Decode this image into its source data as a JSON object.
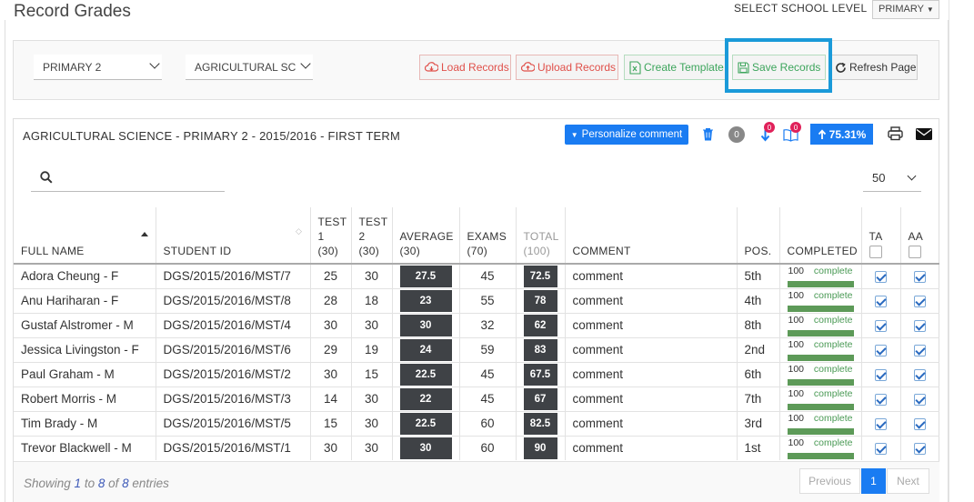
{
  "page": {
    "title": "Record Grades"
  },
  "school_level": {
    "label": "SELECT SCHOOL LEVEL",
    "value": "PRIMARY"
  },
  "filters": {
    "class": "PRIMARY 2",
    "subject": "AGRICULTURAL SC"
  },
  "toolbar": {
    "load": "Load Records",
    "upload": "Upload Records",
    "template": "Create Template",
    "save": "Save Records",
    "refresh": "Refresh Page"
  },
  "grid": {
    "title": "AGRICULTURAL SCIENCE - PRIMARY 2 - 2015/2016 - FIRST TERM",
    "personalize": "Personalize comment",
    "count": "0",
    "notif1": "0",
    "notif2": "0",
    "percent": "75.31%",
    "page_size": "50",
    "search_placeholder": ""
  },
  "columns": {
    "full_name": "FULL NAME",
    "student_id": "STUDENT ID",
    "test1_l1": "TEST",
    "test1_l2": "1",
    "test1_l3": "(30)",
    "test2_l1": "TEST",
    "test2_l2": "2",
    "test2_l3": "(30)",
    "avg_l1": "AVERAGE",
    "avg_l2": "(30)",
    "exam_l1": "EXAMS",
    "exam_l2": "(70)",
    "total_l1": "TOTAL",
    "total_l2": "(100)",
    "comment": "COMMENT",
    "pos": "POS.",
    "completed": "COMPLETED",
    "ta": "TA",
    "aa": "AA"
  },
  "rows": [
    {
      "name": "Adora  Cheung - F",
      "id": "DGS/2015/2016/MST/7",
      "t1": "25",
      "t2": "30",
      "avg": "27.5",
      "exam": "45",
      "total": "72.5",
      "comment": "comment",
      "pos": "5th",
      "pct": "100",
      "status": "complete",
      "ta": true,
      "aa": true
    },
    {
      "name": "Anu  Hariharan - F",
      "id": "DGS/2015/2016/MST/8",
      "t1": "28",
      "t2": "18",
      "avg": "23",
      "exam": "55",
      "total": "78",
      "comment": "comment",
      "pos": "4th",
      "pct": "100",
      "status": "complete",
      "ta": true,
      "aa": true
    },
    {
      "name": "Gustaf  Alstromer - M",
      "id": "DGS/2015/2016/MST/4",
      "t1": "30",
      "t2": "30",
      "avg": "30",
      "exam": "32",
      "total": "62",
      "comment": "comment",
      "pos": "8th",
      "pct": "100",
      "status": "complete",
      "ta": true,
      "aa": true
    },
    {
      "name": "Jessica  Livingston - F",
      "id": "DGS/2015/2016/MST/6",
      "t1": "29",
      "t2": "19",
      "avg": "24",
      "exam": "59",
      "total": "83",
      "comment": "comment",
      "pos": "2nd",
      "pct": "100",
      "status": "complete",
      "ta": true,
      "aa": true
    },
    {
      "name": "Paul  Graham - M",
      "id": "DGS/2015/2016/MST/2",
      "t1": "30",
      "t2": "15",
      "avg": "22.5",
      "exam": "45",
      "total": "67.5",
      "comment": "comment",
      "pos": "6th",
      "pct": "100",
      "status": "complete",
      "ta": true,
      "aa": true
    },
    {
      "name": "Robert  Morris - M",
      "id": "DGS/2015/2016/MST/3",
      "t1": "14",
      "t2": "30",
      "avg": "22",
      "exam": "45",
      "total": "67",
      "comment": "comment",
      "pos": "7th",
      "pct": "100",
      "status": "complete",
      "ta": true,
      "aa": true
    },
    {
      "name": "Tim  Brady - M",
      "id": "DGS/2015/2016/MST/5",
      "t1": "15",
      "t2": "30",
      "avg": "22.5",
      "exam": "60",
      "total": "82.5",
      "comment": "comment",
      "pos": "3rd",
      "pct": "100",
      "status": "complete",
      "ta": true,
      "aa": true
    },
    {
      "name": "Trevor  Blackwell - M",
      "id": "DGS/2015/2016/MST/1",
      "t1": "30",
      "t2": "30",
      "avg": "30",
      "exam": "60",
      "total": "90",
      "comment": "comment",
      "pos": "1st",
      "pct": "100",
      "status": "complete",
      "ta": true,
      "aa": true
    }
  ],
  "footer": {
    "showing_prefix": "Showing ",
    "from": "1",
    "to_word": " to ",
    "to": "8",
    "of_word": " of ",
    "total": "8",
    "suffix": " entries",
    "previous": "Previous",
    "page": "1",
    "next": "Next"
  },
  "colors": {
    "accent": "#1a7cf2",
    "highlight": "#1a9ad9",
    "danger": "#e0504a",
    "success": "#3da55c"
  }
}
